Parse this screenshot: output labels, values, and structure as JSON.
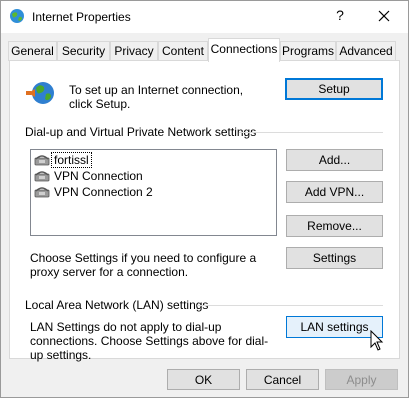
{
  "window": {
    "title": "Internet Properties",
    "help_label": "?",
    "close_label": "✕"
  },
  "tabs": [
    {
      "label": "General"
    },
    {
      "label": "Security"
    },
    {
      "label": "Privacy"
    },
    {
      "label": "Content"
    },
    {
      "label": "Connections"
    },
    {
      "label": "Programs"
    },
    {
      "label": "Advanced"
    }
  ],
  "active_tab": "Connections",
  "setup": {
    "text": "To set up an Internet connection, click Setup.",
    "button": "Setup"
  },
  "vpn": {
    "heading": "Dial-up and Virtual Private Network settings",
    "items": [
      {
        "label": "fortissl",
        "selected": true
      },
      {
        "label": "VPN Connection",
        "selected": false
      },
      {
        "label": "VPN Connection 2",
        "selected": false
      }
    ],
    "add_button": "Add...",
    "add_vpn_button": "Add VPN...",
    "remove_button": "Remove...",
    "settings_text": "Choose Settings if you need to configure a proxy server for a connection.",
    "settings_button": "Settings"
  },
  "lan": {
    "heading": "Local Area Network (LAN) settings",
    "text": "LAN Settings do not apply to dial-up connections. Choose Settings above for dial-up settings.",
    "button": "LAN settings"
  },
  "footer": {
    "ok": "OK",
    "cancel": "Cancel",
    "apply": "Apply"
  }
}
